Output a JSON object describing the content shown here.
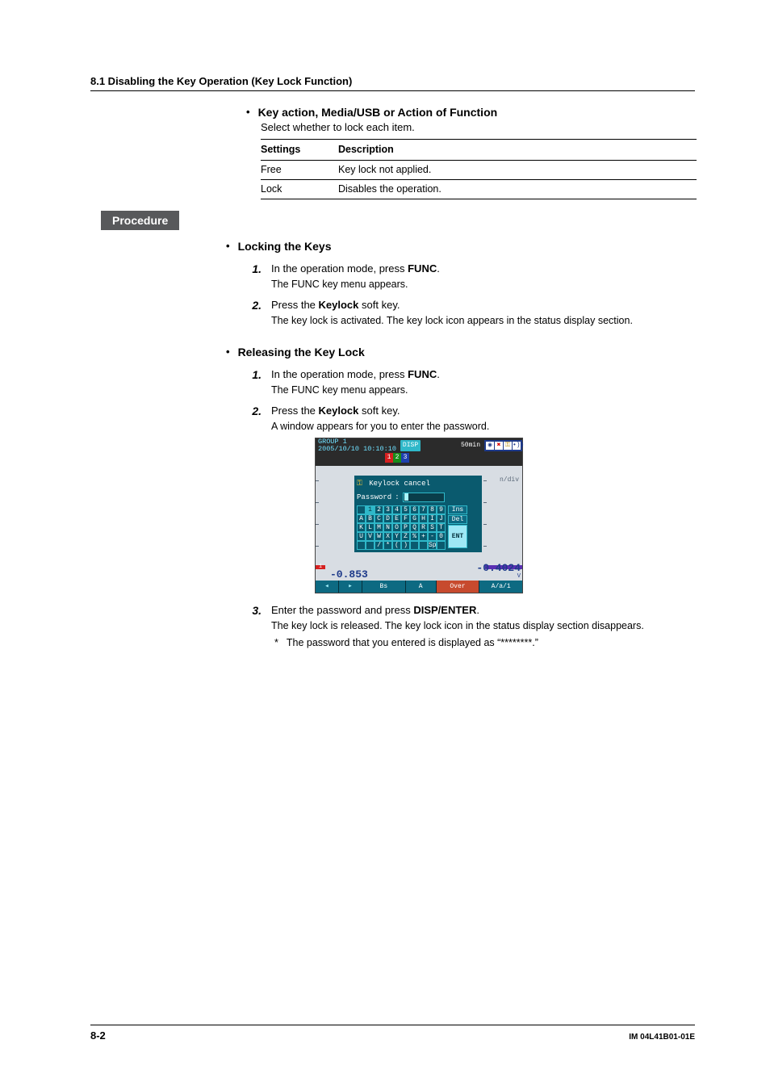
{
  "header": "8.1  Disabling the Key Operation (Key Lock Function)",
  "section1": {
    "title": "Key action, Media/USB or Action of Function",
    "subtitle": "Select whether to lock each item.",
    "table": {
      "h1": "Settings",
      "h2": "Description",
      "rows": [
        {
          "c1": "Free",
          "c2": "Key lock not applied."
        },
        {
          "c1": "Lock",
          "c2": "Disables the operation."
        }
      ]
    }
  },
  "procedure_label": "Procedure",
  "lock": {
    "title": "Locking the Keys",
    "s1_pre": "In the operation mode, press ",
    "s1_b": "FUNC",
    "s1_post": ".",
    "s1_note": "The FUNC key menu appears.",
    "s2_pre": "Press the ",
    "s2_b": "Keylock",
    "s2_post": " soft key.",
    "s2_note": "The key lock is activated. The key lock icon appears in the status display section."
  },
  "release": {
    "title": "Releasing the Key Lock",
    "s1_pre": "In the operation mode, press ",
    "s1_b": "FUNC",
    "s1_post": ".",
    "s1_note": "The FUNC key menu appears.",
    "s2_pre": "Press the ",
    "s2_b": "Keylock",
    "s2_post": " soft key.",
    "s2_note": "A window appears for you to enter the password.",
    "s3_pre": "Enter the password and press ",
    "s3_b": "DISP/ENTER",
    "s3_post": ".",
    "s3_note": "The key lock is released. The key lock icon in the status display section disappears.",
    "asterisk": "The password that you entered is displayed as “********.”"
  },
  "device": {
    "group_line1": "GROUP 1",
    "group_line2": "2005/10/10 10:10:10",
    "disp": "DISP",
    "fifty": "50min",
    "tabs": [
      "1",
      "2",
      "3"
    ],
    "ndiv": "n/div",
    "dlg_title": "Keylock cancel",
    "pw_label": "Password",
    "colon": ":",
    "grid": [
      [
        "",
        "1",
        "2",
        "3",
        "4",
        "5",
        "6",
        "7",
        "8",
        "9"
      ],
      [
        "A",
        "B",
        "C",
        "D",
        "E",
        "F",
        "G",
        "H",
        "I",
        "J"
      ],
      [
        "K",
        "L",
        "M",
        "N",
        "O",
        "P",
        "Q",
        "R",
        "S",
        "T"
      ],
      [
        "U",
        "V",
        "W",
        "X",
        "Y",
        "Z",
        "%",
        "+",
        "-",
        "0"
      ],
      [
        "",
        "",
        "/",
        "*",
        "(",
        ")",
        "",
        "",
        "Sp",
        ""
      ]
    ],
    "side": {
      "ins": "Ins",
      "del": "Del",
      "ent": "ENT"
    },
    "val_left": "-0.853",
    "val_right": "-0.4024",
    "unit": "V",
    "bottom": {
      "bs": "Bs",
      "a": "A",
      "over": "Over",
      "aa1": "A/a/1"
    }
  },
  "footer": {
    "page": "8-2",
    "doc": "IM 04L41B01-01E"
  }
}
